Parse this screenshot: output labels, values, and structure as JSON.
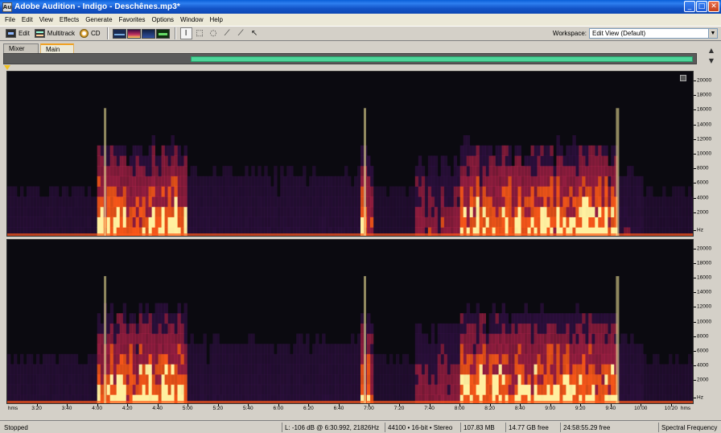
{
  "window": {
    "title": "Adobe Audition - Indigo - Deschênes.mp3*",
    "app_icon": "Au",
    "buttons": {
      "minimize": "_",
      "maximize": "□",
      "close": "✕"
    }
  },
  "menu": [
    "File",
    "Edit",
    "View",
    "Effects",
    "Generate",
    "Favorites",
    "Options",
    "Window",
    "Help"
  ],
  "toolbar": {
    "edit_label": "Edit",
    "multitrack_label": "Multitrack",
    "cd_label": "CD",
    "workspace_label": "Workspace:",
    "workspace_value": "Edit View (Default)",
    "view_icons": [
      "waveform-view-icon",
      "spectral-frequency-view-icon",
      "spectral-pan-view-icon",
      "spectral-phase-view-icon"
    ],
    "tool_icons": [
      "time-selection-tool-icon",
      "marquee-selection-tool-icon",
      "lasso-selection-tool-icon",
      "effects-paintbrush-tool-icon",
      "spot-healing-brush-tool-icon",
      "scrub-tool-icon"
    ]
  },
  "tabs": [
    {
      "label": "Mixer",
      "active": false
    },
    {
      "label": "Main",
      "active": true
    }
  ],
  "overview": {
    "visible_start": 0.27,
    "visible_end": 1.0,
    "fill_color": "#4dd59a"
  },
  "frequency_axis": {
    "unit": "Hz",
    "top_labels": [
      "20000",
      "18000",
      "16000",
      "14000",
      "12000",
      "10000",
      "8000",
      "6000",
      "4000",
      "2000",
      "Hz"
    ],
    "bottom_labels": [
      "20000",
      "18000",
      "16000",
      "14000",
      "12000",
      "10000",
      "8000",
      "6000",
      "4000",
      "2000",
      "Hz"
    ]
  },
  "time_axis": {
    "start_label": "hms",
    "end_label": "hms",
    "labels": [
      "3:20",
      "3:40",
      "4:00",
      "4:20",
      "4:40",
      "5:00",
      "5:20",
      "5:40",
      "6:00",
      "6:20",
      "6:40",
      "7:00",
      "7:20",
      "7:40",
      "8:00",
      "8:20",
      "8:40",
      "9:00",
      "9:20",
      "9:40",
      "10:00",
      "10:20"
    ]
  },
  "spectrogram": {
    "colors": {
      "background": "#0b0a10",
      "low": "#3a1250",
      "mid": "#b0224a",
      "high": "#ff5a1a",
      "peak": "#fff0a0"
    },
    "loud_sections": [
      {
        "start": "4:00",
        "end": "5:00",
        "level": 0.95
      },
      {
        "start": "6:53",
        "end": "7:02",
        "level": 0.85
      },
      {
        "start": "7:30",
        "end": "8:00",
        "level": 0.55
      },
      {
        "start": "8:00",
        "end": "9:40",
        "level": 0.95
      },
      {
        "start": "9:40",
        "end": "9:45",
        "level": 1.0
      }
    ]
  },
  "status": {
    "state": "Stopped",
    "level": "L: -106 dB @  6:30.992, 21826Hz",
    "format": "44100 • 16-bit • Stereo",
    "size": "107.83 MB",
    "free": "14.77 GB free",
    "free_time": "24:58:55.29 free",
    "view": "Spectral Frequency"
  }
}
